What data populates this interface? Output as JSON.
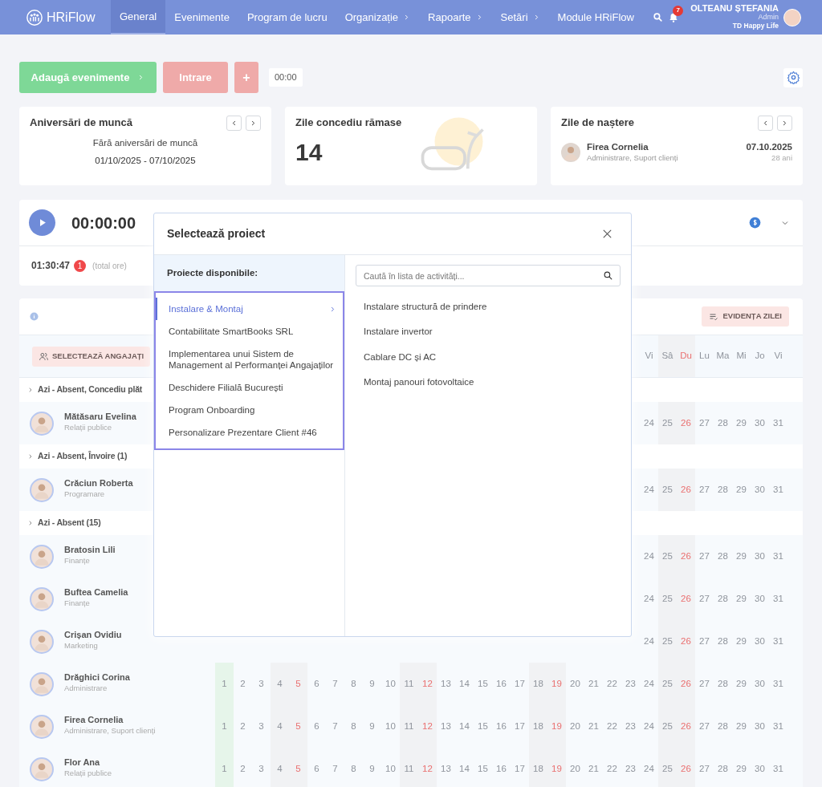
{
  "nav": {
    "logo": "HRiFlow",
    "items": [
      {
        "label": "General",
        "selected": true,
        "submenu": false
      },
      {
        "label": "Evenimente",
        "selected": false,
        "submenu": false
      },
      {
        "label": "Program de lucru",
        "selected": false,
        "submenu": false
      },
      {
        "label": "Organizație",
        "selected": false,
        "submenu": true
      },
      {
        "label": "Rapoarte",
        "selected": false,
        "submenu": true
      },
      {
        "label": "Setări",
        "selected": false,
        "submenu": true
      },
      {
        "label": "Module HRiFlow",
        "selected": false,
        "submenu": false
      }
    ],
    "notifications": "7",
    "user": {
      "name": "OLTEANU ȘTEFANIA",
      "role": "Admin",
      "company": "TD Happy Life"
    }
  },
  "actions": {
    "add_events": "Adaugă evenimente",
    "check_in": "Intrare",
    "plus": "+",
    "time": "00:00"
  },
  "cards": [
    {
      "kind": "anniversary",
      "title": "Aniversări de muncă",
      "message": "Fără aniversări de muncă",
      "range": "01/10/2025 - 07/10/2025"
    },
    {
      "kind": "leave",
      "title": "Zile concediu rămase",
      "value": "14"
    },
    {
      "kind": "birthdays",
      "title": "Zile de naștere",
      "person": {
        "name": "Firea Cornelia",
        "department": "Administrare, Suport clienți",
        "date": "07.10.2025",
        "age": "28 ani"
      }
    }
  ],
  "timer": {
    "time": "00:00:00",
    "total": "01:30:47",
    "badge": "1",
    "total_label": "(total ore)"
  },
  "table": {
    "select_employees": "SELECTEAZĂ ANGAJAȚI",
    "day_record": "EVIDENȚA ZILEI",
    "header_days": [
      {
        "label": "Vi",
        "kind": "weekday"
      },
      {
        "label": "Sâ",
        "kind": "saturday"
      },
      {
        "label": "Du",
        "kind": "sunday"
      },
      {
        "label": "Lu",
        "kind": "weekday"
      },
      {
        "label": "Ma",
        "kind": "weekday"
      },
      {
        "label": "Mi",
        "kind": "weekday"
      },
      {
        "label": "Jo",
        "kind": "weekday"
      },
      {
        "label": "Vi",
        "kind": "weekday"
      }
    ],
    "rows": [
      {
        "kind": "group",
        "label": "Azi - Absent, Concediu plăt"
      },
      {
        "kind": "person",
        "name": "Mătăsaru Evelina",
        "department": "Relații publice",
        "days": [
          {
            "label": "24",
            "kind": "weekday"
          },
          {
            "label": "25",
            "kind": "saturday"
          },
          {
            "label": "26",
            "kind": "sunday"
          },
          {
            "label": "27",
            "kind": "weekday"
          },
          {
            "label": "28",
            "kind": "weekday"
          },
          {
            "label": "29",
            "kind": "weekday"
          },
          {
            "label": "30",
            "kind": "weekday"
          },
          {
            "label": "31",
            "kind": "weekday"
          }
        ]
      },
      {
        "kind": "group",
        "label": "Azi - Absent, Învoire (1)"
      },
      {
        "kind": "person",
        "name": "Crăciun Roberta",
        "department": "Programare",
        "days": [
          {
            "label": "24",
            "kind": "weekday"
          },
          {
            "label": "25",
            "kind": "saturday"
          },
          {
            "label": "26",
            "kind": "sunday"
          },
          {
            "label": "27",
            "kind": "weekday"
          },
          {
            "label": "28",
            "kind": "weekday"
          },
          {
            "label": "29",
            "kind": "weekday"
          },
          {
            "label": "30",
            "kind": "weekday"
          },
          {
            "label": "31",
            "kind": "weekday"
          }
        ]
      },
      {
        "kind": "group",
        "label": "Azi - Absent (15)"
      },
      {
        "kind": "person",
        "name": "Bratosin Lili",
        "department": "Finanțe",
        "days": [
          {
            "label": "24",
            "kind": "weekday"
          },
          {
            "label": "25",
            "kind": "saturday"
          },
          {
            "label": "26",
            "kind": "sunday"
          },
          {
            "label": "27",
            "kind": "weekday"
          },
          {
            "label": "28",
            "kind": "weekday"
          },
          {
            "label": "29",
            "kind": "weekday"
          },
          {
            "label": "30",
            "kind": "weekday"
          },
          {
            "label": "31",
            "kind": "weekday"
          }
        ]
      },
      {
        "kind": "person",
        "name": "Buftea Camelia",
        "department": "Finanțe",
        "days": [
          {
            "label": "24",
            "kind": "weekday"
          },
          {
            "label": "25",
            "kind": "saturday"
          },
          {
            "label": "26",
            "kind": "sunday"
          },
          {
            "label": "27",
            "kind": "weekday"
          },
          {
            "label": "28",
            "kind": "weekday"
          },
          {
            "label": "29",
            "kind": "weekday"
          },
          {
            "label": "30",
            "kind": "weekday"
          },
          {
            "label": "31",
            "kind": "weekday"
          }
        ]
      },
      {
        "kind": "person",
        "name": "Crișan Ovidiu",
        "department": "Marketing",
        "days": [
          {
            "label": "24",
            "kind": "weekday"
          },
          {
            "label": "25",
            "kind": "saturday"
          },
          {
            "label": "26",
            "kind": "sunday"
          },
          {
            "label": "27",
            "kind": "weekday"
          },
          {
            "label": "28",
            "kind": "weekday"
          },
          {
            "label": "29",
            "kind": "weekday"
          },
          {
            "label": "30",
            "kind": "weekday"
          },
          {
            "label": "31",
            "kind": "weekday"
          }
        ]
      },
      {
        "kind": "person",
        "name": "Drăghici Corina",
        "department": "Administrare",
        "days": [
          {
            "label": "1",
            "kind": "today"
          },
          {
            "label": "2",
            "kind": "weekday"
          },
          {
            "label": "3",
            "kind": "weekday"
          },
          {
            "label": "4",
            "kind": "saturday"
          },
          {
            "label": "5",
            "kind": "sunday"
          },
          {
            "label": "6",
            "kind": "weekday"
          },
          {
            "label": "7",
            "kind": "weekday"
          },
          {
            "label": "8",
            "kind": "weekday"
          },
          {
            "label": "9",
            "kind": "weekday"
          },
          {
            "label": "10",
            "kind": "weekday"
          },
          {
            "label": "11",
            "kind": "saturday"
          },
          {
            "label": "12",
            "kind": "sunday"
          },
          {
            "label": "13",
            "kind": "weekday"
          },
          {
            "label": "14",
            "kind": "weekday"
          },
          {
            "label": "15",
            "kind": "weekday"
          },
          {
            "label": "16",
            "kind": "weekday"
          },
          {
            "label": "17",
            "kind": "weekday"
          },
          {
            "label": "18",
            "kind": "saturday"
          },
          {
            "label": "19",
            "kind": "sunday"
          },
          {
            "label": "20",
            "kind": "weekday"
          },
          {
            "label": "21",
            "kind": "weekday"
          },
          {
            "label": "22",
            "kind": "weekday"
          },
          {
            "label": "23",
            "kind": "weekday"
          },
          {
            "label": "24",
            "kind": "weekday"
          },
          {
            "label": "25",
            "kind": "saturday"
          },
          {
            "label": "26",
            "kind": "sunday"
          },
          {
            "label": "27",
            "kind": "weekday"
          },
          {
            "label": "28",
            "kind": "weekday"
          },
          {
            "label": "29",
            "kind": "weekday"
          },
          {
            "label": "30",
            "kind": "weekday"
          },
          {
            "label": "31",
            "kind": "weekday"
          }
        ]
      },
      {
        "kind": "person",
        "name": "Firea Cornelia",
        "department": "Administrare, Suport clienți",
        "days": [
          {
            "label": "1",
            "kind": "today"
          },
          {
            "label": "2",
            "kind": "weekday"
          },
          {
            "label": "3",
            "kind": "weekday"
          },
          {
            "label": "4",
            "kind": "saturday"
          },
          {
            "label": "5",
            "kind": "sunday"
          },
          {
            "label": "6",
            "kind": "weekday"
          },
          {
            "label": "7",
            "kind": "weekday"
          },
          {
            "label": "8",
            "kind": "weekday"
          },
          {
            "label": "9",
            "kind": "weekday"
          },
          {
            "label": "10",
            "kind": "weekday"
          },
          {
            "label": "11",
            "kind": "saturday"
          },
          {
            "label": "12",
            "kind": "sunday"
          },
          {
            "label": "13",
            "kind": "weekday"
          },
          {
            "label": "14",
            "kind": "weekday"
          },
          {
            "label": "15",
            "kind": "weekday"
          },
          {
            "label": "16",
            "kind": "weekday"
          },
          {
            "label": "17",
            "kind": "weekday"
          },
          {
            "label": "18",
            "kind": "saturday"
          },
          {
            "label": "19",
            "kind": "sunday"
          },
          {
            "label": "20",
            "kind": "weekday"
          },
          {
            "label": "21",
            "kind": "weekday"
          },
          {
            "label": "22",
            "kind": "weekday"
          },
          {
            "label": "23",
            "kind": "weekday"
          },
          {
            "label": "24",
            "kind": "weekday"
          },
          {
            "label": "25",
            "kind": "saturday"
          },
          {
            "label": "26",
            "kind": "sunday"
          },
          {
            "label": "27",
            "kind": "weekday"
          },
          {
            "label": "28",
            "kind": "weekday"
          },
          {
            "label": "29",
            "kind": "weekday"
          },
          {
            "label": "30",
            "kind": "weekday"
          },
          {
            "label": "31",
            "kind": "weekday"
          }
        ]
      },
      {
        "kind": "person",
        "name": "Flor Ana",
        "department": "Relații publice",
        "days": [
          {
            "label": "1",
            "kind": "today"
          },
          {
            "label": "2",
            "kind": "weekday"
          },
          {
            "label": "3",
            "kind": "weekday"
          },
          {
            "label": "4",
            "kind": "saturday"
          },
          {
            "label": "5",
            "kind": "sunday"
          },
          {
            "label": "6",
            "kind": "weekday"
          },
          {
            "label": "7",
            "kind": "weekday"
          },
          {
            "label": "8",
            "kind": "weekday"
          },
          {
            "label": "9",
            "kind": "weekday"
          },
          {
            "label": "10",
            "kind": "weekday"
          },
          {
            "label": "11",
            "kind": "saturday"
          },
          {
            "label": "12",
            "kind": "sunday"
          },
          {
            "label": "13",
            "kind": "weekday"
          },
          {
            "label": "14",
            "kind": "weekday"
          },
          {
            "label": "15",
            "kind": "weekday"
          },
          {
            "label": "16",
            "kind": "weekday"
          },
          {
            "label": "17",
            "kind": "weekday"
          },
          {
            "label": "18",
            "kind": "saturday"
          },
          {
            "label": "19",
            "kind": "sunday"
          },
          {
            "label": "20",
            "kind": "weekday"
          },
          {
            "label": "21",
            "kind": "weekday"
          },
          {
            "label": "22",
            "kind": "weekday"
          },
          {
            "label": "23",
            "kind": "weekday"
          },
          {
            "label": "24",
            "kind": "weekday"
          },
          {
            "label": "25",
            "kind": "saturday"
          },
          {
            "label": "26",
            "kind": "sunday"
          },
          {
            "label": "27",
            "kind": "weekday"
          },
          {
            "label": "28",
            "kind": "weekday"
          },
          {
            "label": "29",
            "kind": "weekday"
          },
          {
            "label": "30",
            "kind": "weekday"
          },
          {
            "label": "31",
            "kind": "weekday"
          }
        ]
      }
    ]
  },
  "modal": {
    "title": "Selectează proiect",
    "projects_label": "Proiecte disponibile:",
    "search_placeholder": "Caută în lista de activități...",
    "projects": [
      {
        "label": "Instalare & Montaj",
        "selected": true
      },
      {
        "label": "Contabilitate SmartBooks SRL",
        "selected": false
      },
      {
        "label": "Implementarea unui Sistem de Management al Performanței Angajaților",
        "selected": false
      },
      {
        "label": "Deschidere Filială București",
        "selected": false
      },
      {
        "label": "Program Onboarding",
        "selected": false
      },
      {
        "label": "Personalizare Prezentare Client #46",
        "selected": false
      }
    ],
    "activities": [
      "Instalare structură de prindere",
      "Instalare invertor",
      "Cablare DC și AC",
      "Montaj panouri fotovoltaice"
    ]
  }
}
